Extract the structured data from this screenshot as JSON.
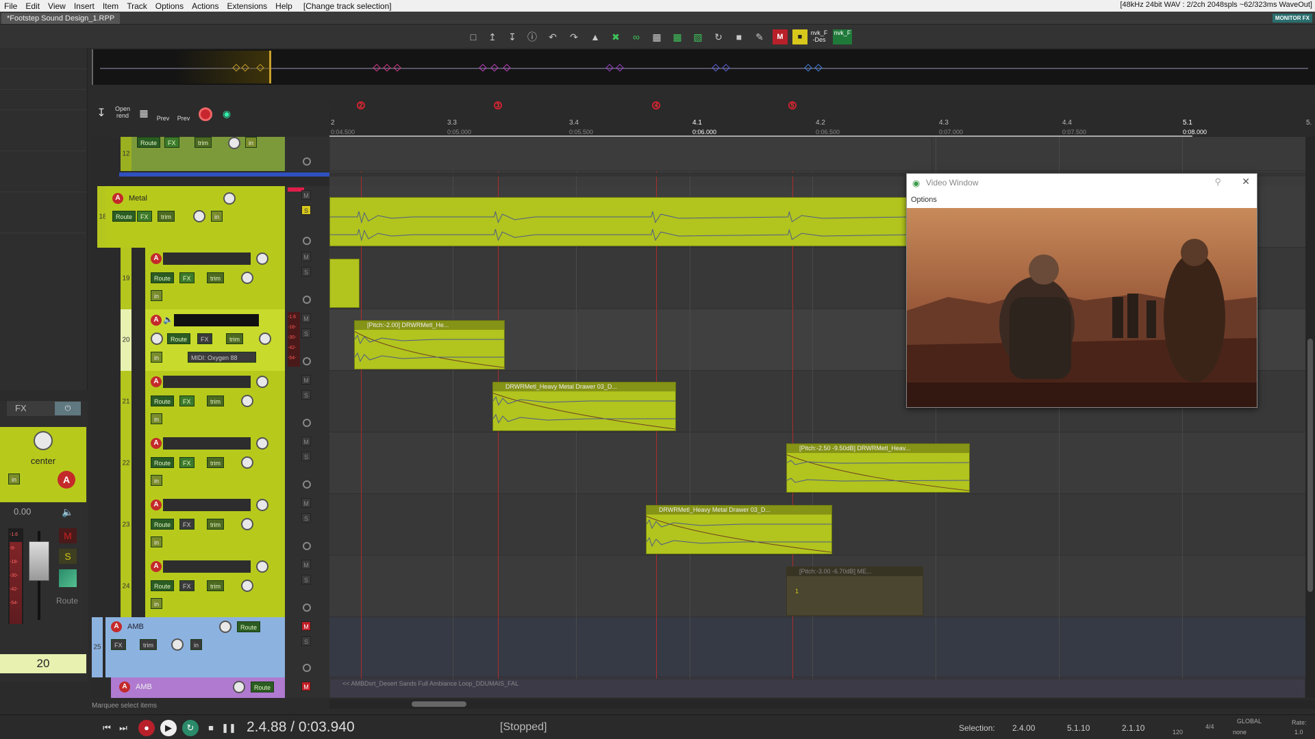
{
  "menu": {
    "items": [
      "File",
      "Edit",
      "View",
      "Insert",
      "Item",
      "Track",
      "Options",
      "Actions",
      "Extensions",
      "Help"
    ],
    "last_action": "[Change track selection]",
    "audio_status": "[48kHz 24bit WAV : 2/2ch 2048spls ~62/323ms WaveOut]"
  },
  "project_tab": "*Footstep Sound Design_1.RPP",
  "monitor_fx": "MONITOR FX",
  "toolbar": {
    "nvk_f_des": "nvk_F -Des",
    "nvk_f": "nvk_F",
    "m_label": "M"
  },
  "render_toolbar": {
    "open_render": "Open rend",
    "prev1": "Prev",
    "prev2": "Prev"
  },
  "ruler": {
    "markers": [
      "2",
      "3",
      "4",
      "5"
    ],
    "measures": [
      {
        "label": "2",
        "sub": "0:04.500"
      },
      {
        "label": "3.3",
        "sub": "0:05.000"
      },
      {
        "label": "3.4",
        "sub": "0:05.500"
      },
      {
        "label": "4.1",
        "sub": "0:06.000"
      },
      {
        "label": "4.2",
        "sub": "0:06.500"
      },
      {
        "label": "4.3",
        "sub": "0:07.000"
      },
      {
        "label": "4.4",
        "sub": "0:07.500"
      },
      {
        "label": "5.1",
        "sub": "0:08.000"
      },
      {
        "label": "5.",
        "sub": ""
      }
    ]
  },
  "tracks": {
    "t12": {
      "num": "12"
    },
    "t18": {
      "num": "18",
      "name": "Metal"
    },
    "t19": {
      "num": "19"
    },
    "t20": {
      "num": "20",
      "midi": "MIDI: Oxygen 88"
    },
    "t21": {
      "num": "21"
    },
    "t22": {
      "num": "22"
    },
    "t23": {
      "num": "23"
    },
    "t24": {
      "num": "24"
    },
    "t25": {
      "num": "25",
      "name": "AMB"
    },
    "t26": {
      "name": "AMB"
    }
  },
  "labels": {
    "route": "Route",
    "fx": "FX",
    "trim": "trim",
    "in": "in",
    "m": "M",
    "s": "S",
    "arm": "A"
  },
  "meter_ticks": [
    "-1.6",
    "-18-",
    "-30-",
    "-42-",
    "-54-"
  ],
  "items": {
    "i20": "[Pitch:-2.00] DRWRMetl_He...",
    "i21": "DRWRMetl_Heavy Metal Drawer 03_D...",
    "i22": "[Pitch:-2.50 -9.50dB] DRWRMetl_Heav...",
    "i23": "DRWRMetl_Heavy Metal Drawer 03_D...",
    "i24": "[Pitch:-3.00 -6.70dB] ME...",
    "i24_marker": "1",
    "amb_item": "<< AMBDsrt_Desert Sands Full Ambiance Loop_DDUMAIS_FAL"
  },
  "video_window": {
    "title": "Video Window",
    "options": "Options"
  },
  "master_strip": {
    "fx": "FX",
    "pan_label": "center",
    "in_label": "in",
    "volume": "0.00",
    "meter_ticks": [
      "-1.6",
      "-6-",
      "-18-",
      "-30-",
      "-42-",
      "-54-"
    ],
    "m": "M",
    "s": "S",
    "route": "Route",
    "track_number": "20"
  },
  "status_hint": "Marquee select items",
  "transport": {
    "time": "2.4.88 / 0:03.940",
    "status": "[Stopped]",
    "selection_label": "Selection:",
    "sel_start": "2.4.00",
    "sel_end": "5.1.10",
    "sel_len": "2.1.10",
    "bpm": "120",
    "timesig": "4/4",
    "global": "GLOBAL",
    "none": "none",
    "rate_label": "Rate:",
    "rate": "1.0"
  },
  "colors": {
    "track_green": "#b7ca1c",
    "marker_red": "#d02030",
    "amb_blue": "#8cb2e0",
    "amb_purple": "#b07ad0"
  }
}
